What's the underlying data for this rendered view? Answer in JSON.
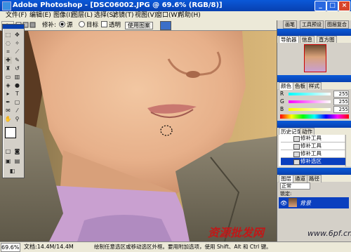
{
  "window": {
    "title": "Adobe Photoshop - [DSC06002.JPG @ 69.6% (RGB/8)]",
    "min_label": "_",
    "max_label": "□",
    "close_label": "×"
  },
  "menu": [
    "文件(F)",
    "编辑(E)",
    "图像(I)",
    "图层(L)",
    "选择(S)",
    "滤镜(T)",
    "视图(V)",
    "窗口(W)",
    "帮助(H)"
  ],
  "options": {
    "patch_label": "修补:",
    "source_label": "源",
    "target_label": "目标",
    "transparent_label": "透明",
    "use_pattern_label": "使用图案"
  },
  "panels": {
    "navigator_tabs": [
      "导航器",
      "信息",
      "直方图"
    ],
    "color_tabs": [
      "颜色",
      "色板",
      "样式"
    ],
    "color": {
      "r_label": "R",
      "r_value": "255",
      "g_label": "G",
      "g_value": "255",
      "b_label": "B",
      "b_value": "255"
    },
    "history_tabs": [
      "历史记录",
      "动作"
    ],
    "history_items": [
      "修补工具",
      "修补工具",
      "修补工具",
      "修补选区"
    ],
    "layers_tabs": [
      "图层",
      "通道",
      "路径"
    ],
    "blend_mode": "正常",
    "lock_label": "锁定:",
    "layer_name": "背景"
  },
  "status": {
    "zoom": "69.6%",
    "doc": "文档:14.4M/14.4M",
    "hint": "绘制任意选区或移动选区外框。要用附加选项，使用 Shift、Alt 和 Ctrl 键。"
  },
  "watermark": "资源批发网",
  "site": "www.6pf.cn",
  "colors": {
    "titlebar": "#0840b0",
    "selected": "#0a3fbf"
  }
}
